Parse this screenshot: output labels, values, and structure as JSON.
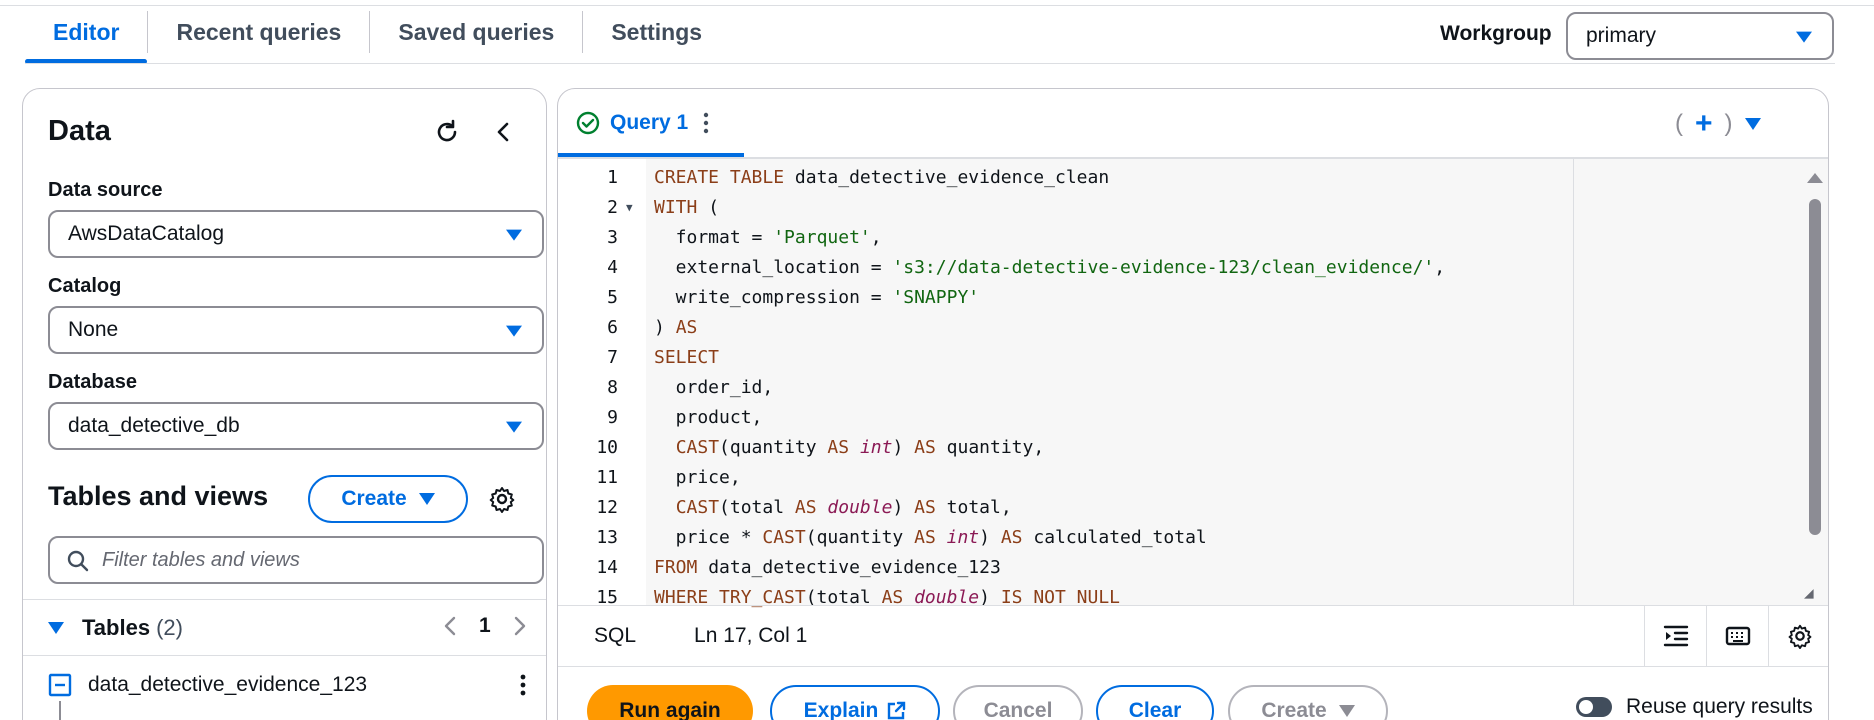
{
  "tabs": [
    {
      "label": "Editor",
      "active": true
    },
    {
      "label": "Recent queries",
      "active": false
    },
    {
      "label": "Saved queries",
      "active": false
    },
    {
      "label": "Settings",
      "active": false
    }
  ],
  "workgroup": {
    "label": "Workgroup",
    "value": "primary"
  },
  "data_panel": {
    "title": "Data",
    "data_source": {
      "label": "Data source",
      "value": "AwsDataCatalog"
    },
    "catalog": {
      "label": "Catalog",
      "value": "None"
    },
    "database": {
      "label": "Database",
      "value": "data_detective_db"
    },
    "tables_views": {
      "title": "Tables and views",
      "create_label": "Create",
      "filter_placeholder": "Filter tables and views"
    },
    "tables": {
      "title": "Tables",
      "count": "(2)",
      "page": "1",
      "items": [
        "data_detective_evidence_123"
      ]
    }
  },
  "query_tab": {
    "label": "Query 1",
    "add_left": "(",
    "add_plus": "+",
    "add_right": ")"
  },
  "editor": {
    "lines": [
      {
        "n": "1",
        "fold": false,
        "tokens": [
          [
            "kw",
            "CREATE TABLE "
          ],
          [
            "",
            "data_detective_evidence_clean"
          ]
        ]
      },
      {
        "n": "2",
        "fold": true,
        "tokens": [
          [
            "kw",
            "WITH"
          ],
          [
            "",
            " ("
          ]
        ]
      },
      {
        "n": "3",
        "fold": false,
        "tokens": [
          [
            "",
            "  format = "
          ],
          [
            "str",
            "'Parquet'"
          ],
          [
            "",
            ","
          ]
        ]
      },
      {
        "n": "4",
        "fold": false,
        "tokens": [
          [
            "",
            "  external_location = "
          ],
          [
            "str",
            "'s3://data-detective-evidence-123/clean_evidence/'"
          ],
          [
            "",
            ","
          ]
        ]
      },
      {
        "n": "5",
        "fold": false,
        "tokens": [
          [
            "",
            "  write_compression = "
          ],
          [
            "str",
            "'SNAPPY'"
          ]
        ]
      },
      {
        "n": "6",
        "fold": false,
        "tokens": [
          [
            "",
            ") "
          ],
          [
            "kw",
            "AS"
          ]
        ]
      },
      {
        "n": "7",
        "fold": false,
        "tokens": [
          [
            "kw",
            "SELECT"
          ]
        ]
      },
      {
        "n": "8",
        "fold": false,
        "tokens": [
          [
            "",
            "  order_id,"
          ]
        ]
      },
      {
        "n": "9",
        "fold": false,
        "tokens": [
          [
            "",
            "  product,"
          ]
        ]
      },
      {
        "n": "10",
        "fold": false,
        "tokens": [
          [
            "",
            "  "
          ],
          [
            "kw",
            "CAST"
          ],
          [
            "",
            "(quantity "
          ],
          [
            "kw",
            "AS "
          ],
          [
            "ty",
            "int"
          ],
          [
            "",
            ") "
          ],
          [
            "kw",
            "AS"
          ],
          [
            "",
            " quantity,"
          ]
        ]
      },
      {
        "n": "11",
        "fold": false,
        "tokens": [
          [
            "",
            "  price,"
          ]
        ]
      },
      {
        "n": "12",
        "fold": false,
        "tokens": [
          [
            "",
            "  "
          ],
          [
            "kw",
            "CAST"
          ],
          [
            "",
            "(total "
          ],
          [
            "kw",
            "AS "
          ],
          [
            "ty",
            "double"
          ],
          [
            "",
            ") "
          ],
          [
            "kw",
            "AS"
          ],
          [
            "",
            " total,"
          ]
        ]
      },
      {
        "n": "13",
        "fold": false,
        "tokens": [
          [
            "",
            "  price * "
          ],
          [
            "kw",
            "CAST"
          ],
          [
            "",
            "(quantity "
          ],
          [
            "kw",
            "AS "
          ],
          [
            "ty",
            "int"
          ],
          [
            "",
            ") "
          ],
          [
            "kw",
            "AS"
          ],
          [
            "",
            " calculated_total"
          ]
        ]
      },
      {
        "n": "14",
        "fold": false,
        "tokens": [
          [
            "kw",
            "FROM"
          ],
          [
            "",
            " data_detective_evidence_123"
          ]
        ]
      },
      {
        "n": "15",
        "fold": false,
        "tokens": [
          [
            "kw",
            "WHERE TRY_CAST"
          ],
          [
            "",
            "(total "
          ],
          [
            "kw",
            "AS "
          ],
          [
            "ty",
            "double"
          ],
          [
            "",
            ") "
          ],
          [
            "kw",
            "IS NOT NULL"
          ]
        ]
      }
    ]
  },
  "status": {
    "language": "SQL",
    "position": "Ln 17, Col 1"
  },
  "actions": {
    "run": "Run again",
    "explain": "Explain",
    "cancel": "Cancel",
    "clear": "Clear",
    "create": "Create",
    "reuse": "Reuse query results"
  },
  "colors": {
    "accent": "#006ce0",
    "primary_button": "#ff9900",
    "success": "#00802f"
  }
}
